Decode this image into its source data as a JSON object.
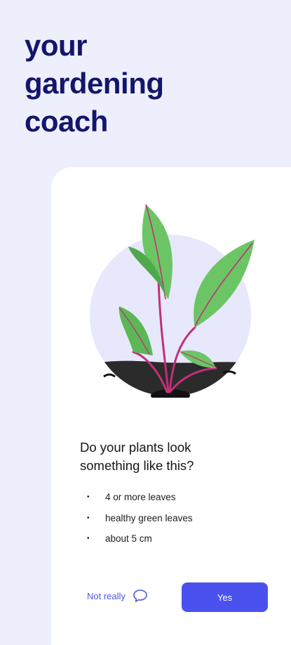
{
  "hero": {
    "title": "your\ngardening\ncoach"
  },
  "card": {
    "question": "Do your plants look\nsomething like this?",
    "criteria": [
      "4 or more leaves",
      "healthy green leaves",
      "about 5 cm"
    ],
    "actions": {
      "not_really_label": "Not really",
      "not_really_icon": "chat-bubble-icon",
      "yes_label": "Yes"
    }
  },
  "colors": {
    "background": "#eeeffc",
    "title": "#13166b",
    "accent": "#4b51ef",
    "leaf": "#6cc565",
    "leaf_dark": "#4fa84a",
    "stem": "#c0307a",
    "soil": "#2b2b2b"
  },
  "illustration": {
    "name": "seedling-illustration"
  }
}
